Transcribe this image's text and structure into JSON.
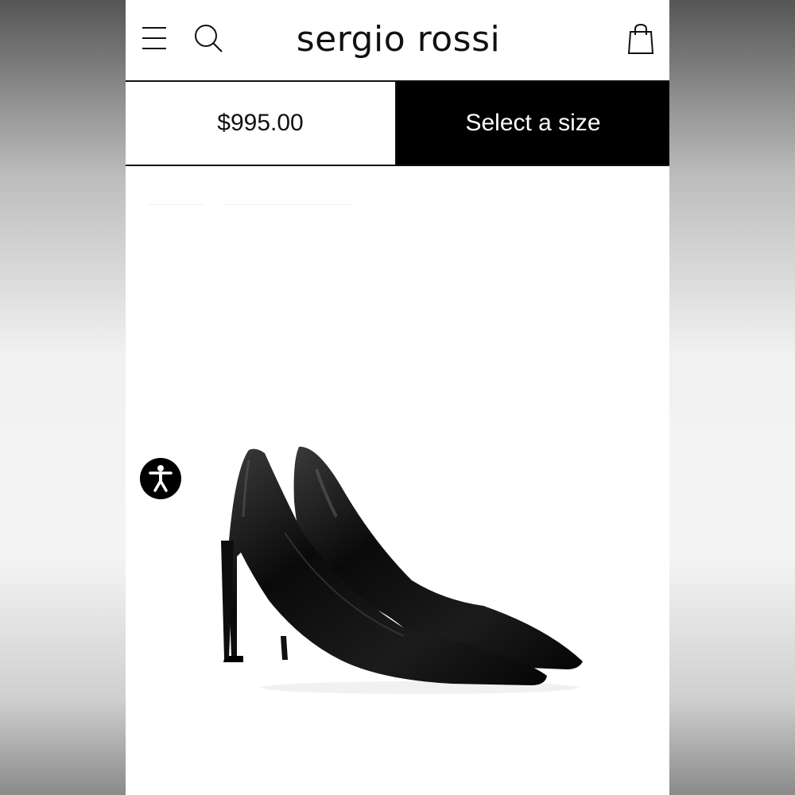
{
  "header": {
    "logo_text": "sergio rossi",
    "menu_icon": "hamburger-menu-icon",
    "search_icon": "search-icon",
    "bag_icon": "shopping-bag-icon"
  },
  "buybar": {
    "price": "$995.00",
    "select_size_label": "Select a size"
  },
  "product": {
    "image_icon": "black-patent-pumps-image"
  },
  "accessibility": {
    "icon": "accessibility-icon"
  },
  "colors": {
    "primary": "#000000",
    "background": "#ffffff"
  }
}
